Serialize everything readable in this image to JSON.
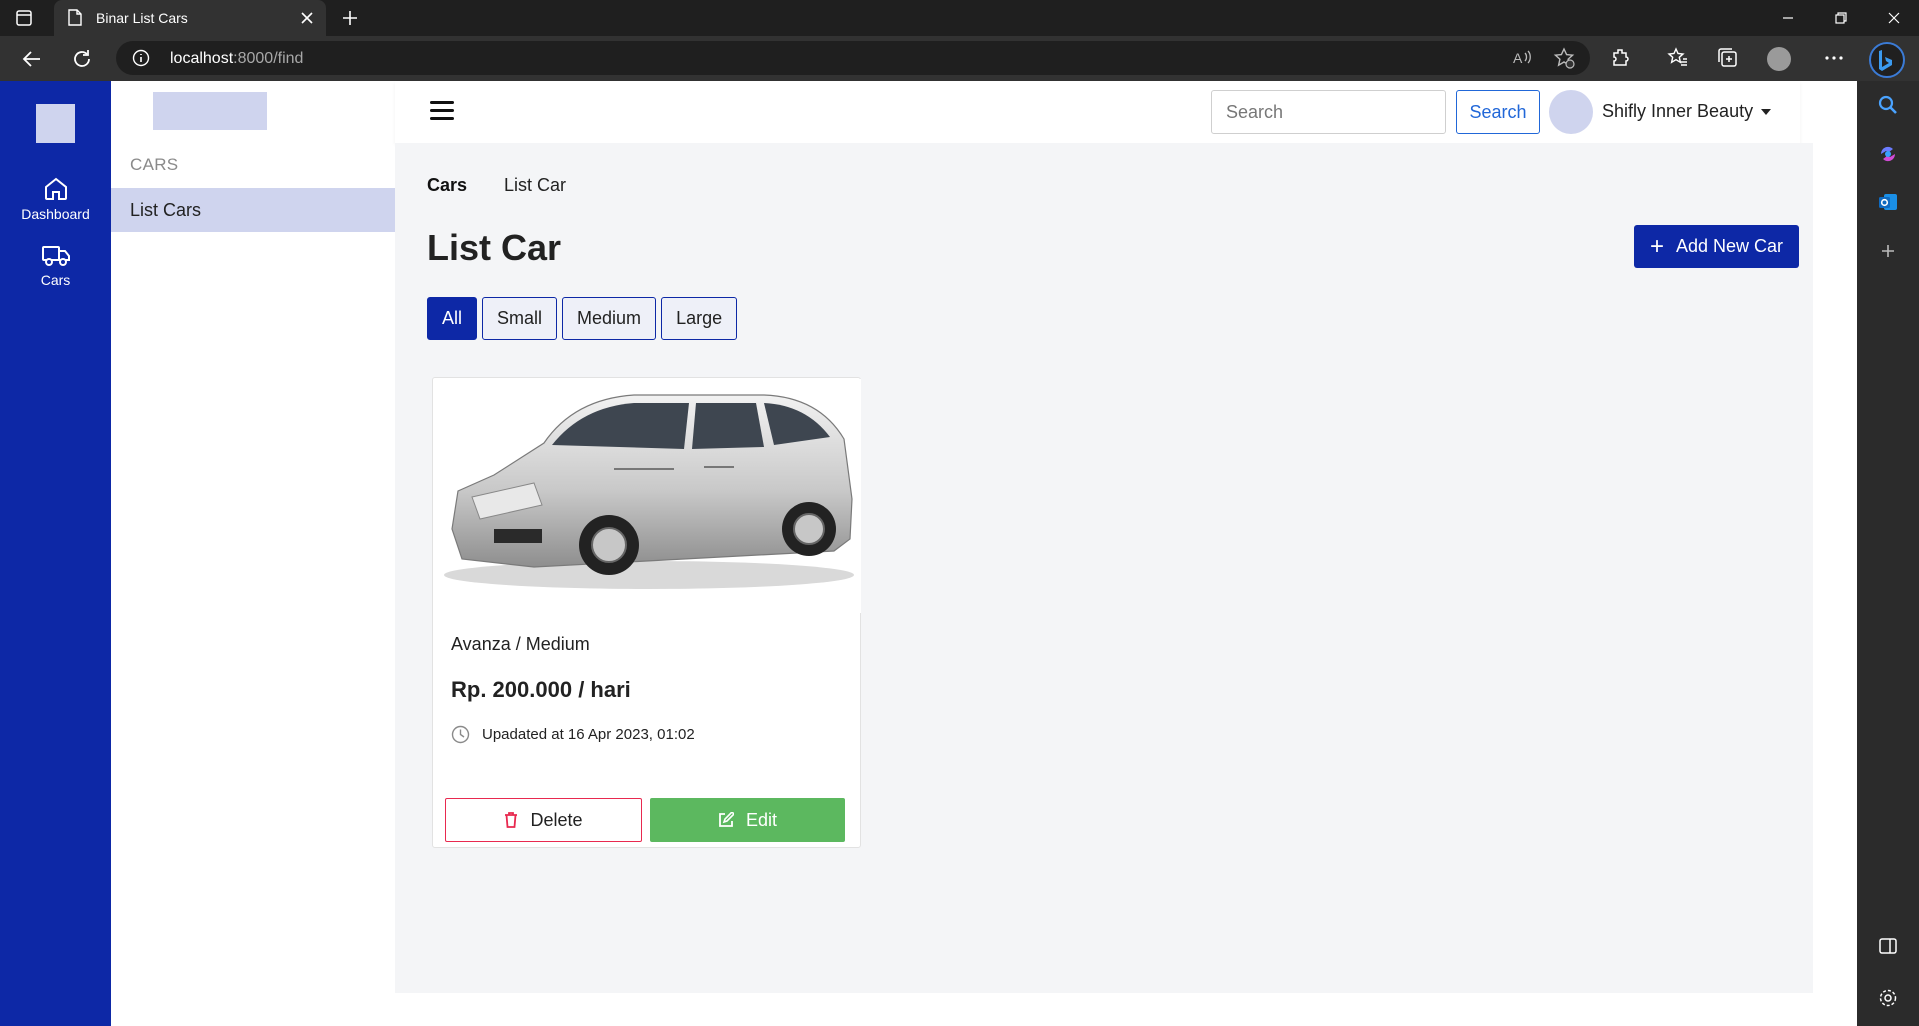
{
  "browser": {
    "tab_title": "Binar List Cars",
    "url_host": "localhost",
    "url_rest": ":8000/find"
  },
  "rail": {
    "items": [
      {
        "label": "Dashboard",
        "icon": "home-icon"
      },
      {
        "label": "Cars",
        "icon": "truck-icon"
      }
    ]
  },
  "subside": {
    "section": "CARS",
    "active_item": "List Cars"
  },
  "topbar": {
    "search_placeholder": "Search",
    "search_button": "Search",
    "user_name": "Shifly Inner Beauty"
  },
  "breadcrumb": {
    "root": "Cars",
    "current": "List Car"
  },
  "page": {
    "title": "List Car",
    "add_button": "Add New Car"
  },
  "filters": {
    "options": [
      "All",
      "Small",
      "Medium",
      "Large"
    ],
    "selected": "All"
  },
  "cars": [
    {
      "name": "Avanza / Medium",
      "price": "Rp. 200.000 / hari",
      "updated": "Upadated at 16 Apr 2023, 01:02",
      "delete_label": "Delete",
      "edit_label": "Edit"
    }
  ],
  "colors": {
    "brand": "#0d28a6",
    "brand_light": "#cfd4ee",
    "danger": "#e8294f",
    "success": "#5cb85f",
    "link": "#2167d8"
  }
}
